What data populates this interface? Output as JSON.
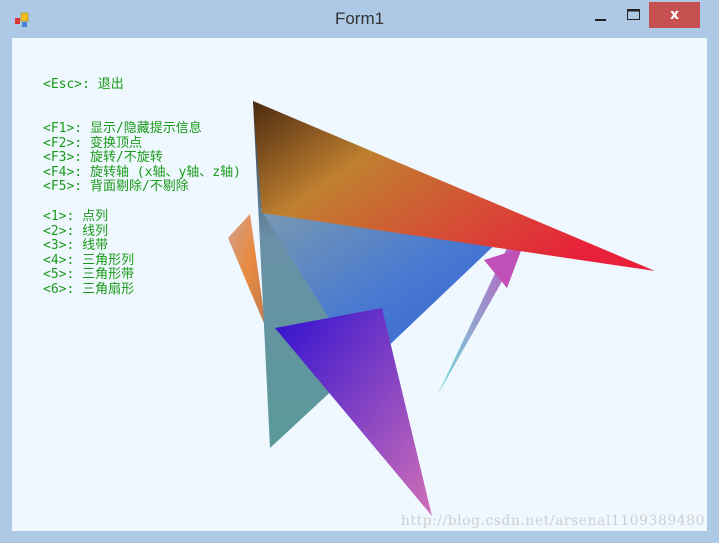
{
  "window": {
    "title": "Form1",
    "minimize_icon": "minimize-icon",
    "maximize_icon": "maximize-icon",
    "close_icon": "close-icon",
    "close_label": "x"
  },
  "help": {
    "esc": "<Esc>: 退出",
    "function_keys": [
      "<F1>: 显示/隐藏提示信息",
      "<F2>: 变换顶点",
      "<F3>: 旋转/不旋转",
      "<F4>: 旋转轴 (x轴、y轴、z轴)",
      "<F5>: 背面剔除/不剔除"
    ],
    "modes": [
      "<1>: 点列",
      "<2>: 线列",
      "<3>: 线带",
      "<4>: 三角形列",
      "<5>: 三角形带",
      "<6>: 三角扇形"
    ]
  },
  "watermark": "http://blog.csdn.net/arsenal1109389480",
  "colors": {
    "text": "#1a9a1a",
    "client_bg": "#f0f8ff",
    "titlebar": "#adc9e6",
    "close": "#c75050"
  }
}
